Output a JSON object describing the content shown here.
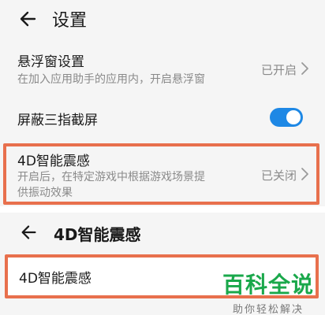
{
  "screen1": {
    "title": "设置",
    "rows": [
      {
        "title": "悬浮窗设置",
        "subtitle": "在加入应用助手的应用内，开启悬浮窗",
        "value": "已开启"
      },
      {
        "title": "屏蔽三指截屏",
        "toggle_on": true
      },
      {
        "title": "4D智能震感",
        "subtitle_line1": "开启后，在特定游戏中根据游戏场景提",
        "subtitle_line2": "供振动效果",
        "value": "已关闭"
      }
    ]
  },
  "screen2": {
    "title": "4D智能震感",
    "item": "4D智能震感"
  },
  "watermark": {
    "main": "百科全说",
    "sub": "助你轻松解决"
  },
  "colors": {
    "highlight": "#e8704d",
    "toggle": "#1e88e5",
    "watermark": "#1aa84b"
  }
}
